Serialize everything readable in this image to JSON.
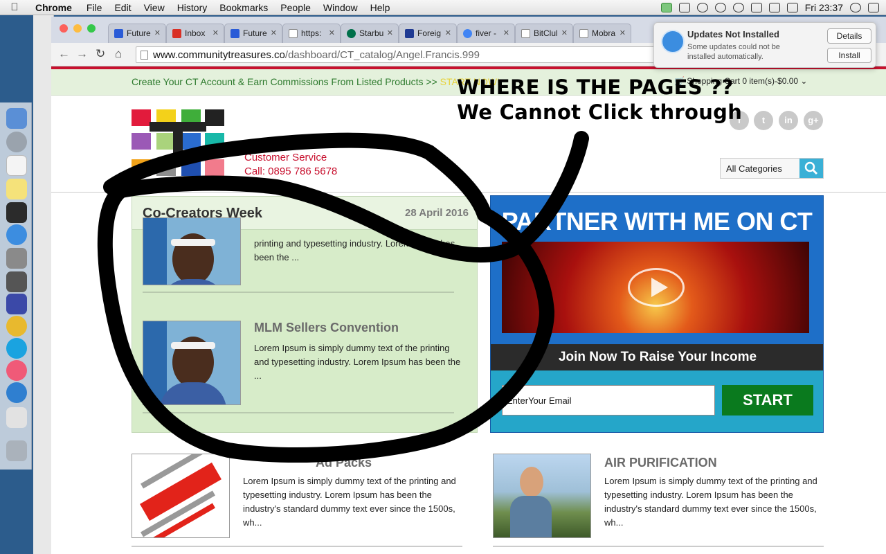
{
  "menubar": {
    "app_name": "Chrome",
    "items": [
      "File",
      "Edit",
      "View",
      "History",
      "Bookmarks",
      "People",
      "Window",
      "Help"
    ],
    "clock": "Fri 23:37"
  },
  "browser": {
    "tabs": [
      {
        "label": "Future",
        "favicon_color": "#2a5bd7"
      },
      {
        "label": "Inbox",
        "favicon_color": "#d93025"
      },
      {
        "label": "Future",
        "favicon_color": "#2a5bd7"
      },
      {
        "label": "https:",
        "favicon_color": "#888888"
      },
      {
        "label": "Starbu",
        "favicon_color": "#00704a"
      },
      {
        "label": "Foreig",
        "favicon_color": "#1f3a93"
      },
      {
        "label": "fiver -",
        "favicon_color": "#4285f4"
      },
      {
        "label": "BitClul",
        "favicon_color": "#888888"
      },
      {
        "label": "Mobra",
        "favicon_color": "#888888"
      }
    ],
    "url_host": "www.communitytreasures.co",
    "url_path": "/dashboard/CT_catalog/Angel.Francis.999"
  },
  "notification": {
    "title": "Updates Not Installed",
    "body": "Some updates could not be installed automatically.",
    "details_label": "Details",
    "install_label": "Install"
  },
  "page": {
    "promo_text": "Create Your CT Account & Earn Commissions From Listed Products >> ",
    "promo_link": "START NOW!",
    "cart_text": "Shopping Cart 0 item(s)-$0.00",
    "customer_service": "Customer Service",
    "phone": "Call: 0895 786 5678",
    "categories_label": "All Categories",
    "news": {
      "title": "Co-Creators Week",
      "date": "28 April 2016",
      "item1_text": "printing and typesetting industry. Lorem Ipsum has been the ...",
      "item2_title": "MLM Sellers Convention",
      "item2_text": "Lorem Ipsum is simply dummy text of the printing and typesetting industry. Lorem Ipsum has been the ..."
    },
    "partner": {
      "heading": "PARTNER WITH ME ON CT",
      "join_text": "Join Now To Raise Your Income",
      "email_placeholder": "EnterYour Email",
      "start_label": "START"
    },
    "products": [
      {
        "title": "Ad Packs",
        "text": "Lorem Ipsum is simply dummy text of the printing and typesetting industry. Lorem Ipsum has been the industry's standard dummy text ever since the 1500s, wh..."
      },
      {
        "title": "AIR PURIFICATION",
        "text": "Lorem Ipsum is simply dummy text of the printing and typesetting industry. Lorem Ipsum has been the industry's standard dummy text ever since the 1500s, wh..."
      }
    ]
  },
  "annotation": {
    "line1": "WHERE IS THE PAGES ??",
    "line2": "We Cannot Click through"
  }
}
